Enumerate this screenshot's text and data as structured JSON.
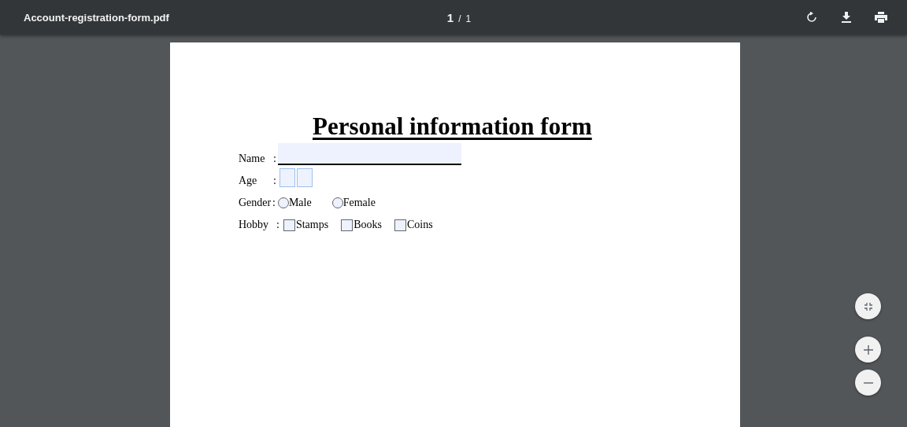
{
  "toolbar": {
    "file_name": "Account-registration-form.pdf",
    "current_page": "1",
    "page_separator": "/",
    "total_pages": "1"
  },
  "document": {
    "title": "Personal information form",
    "name": {
      "label": "Name",
      "colon": ":"
    },
    "age": {
      "label": "Age",
      "colon": ":",
      "boxes": [
        {
          "kind": "digit"
        },
        {
          "kind": "digit"
        }
      ]
    },
    "gender": {
      "label": "Gender",
      "colon": ":",
      "options": [
        {
          "label": "Male",
          "selected": false
        },
        {
          "label": "Female",
          "selected": false
        }
      ]
    },
    "hobby": {
      "label": "Hobby",
      "colon": ":",
      "options": [
        {
          "label": "Stamps",
          "checked": false
        },
        {
          "label": "Books",
          "checked": false
        },
        {
          "label": "Coins",
          "checked": false
        }
      ]
    }
  }
}
